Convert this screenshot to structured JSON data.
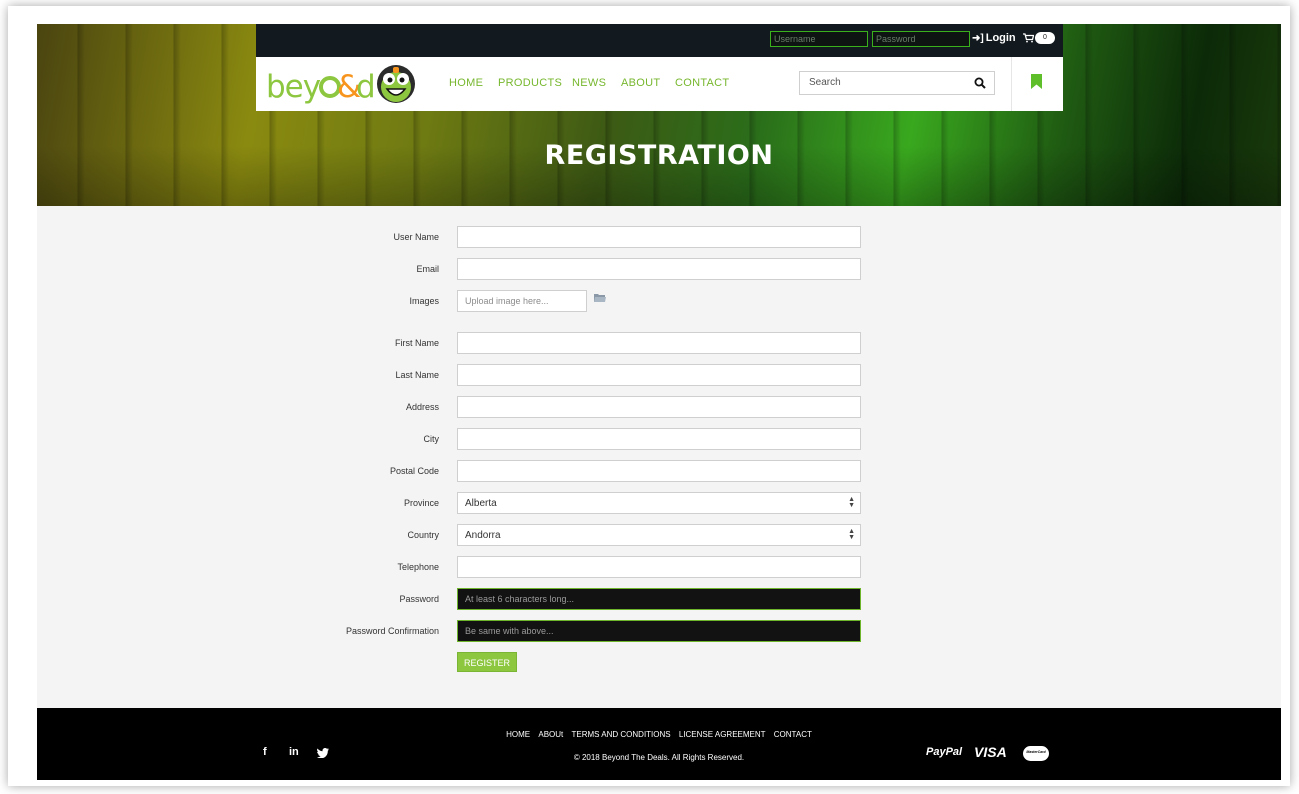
{
  "topbar": {
    "username_placeholder": "Username",
    "password_placeholder": "Password",
    "login_label": "Login",
    "cart_count": "0"
  },
  "brand": {
    "logo_text": "beyo8d"
  },
  "nav": {
    "items": [
      {
        "label": "HOME"
      },
      {
        "label": "PRODUCTS"
      },
      {
        "label": "NEWS"
      },
      {
        "label": "ABOUT"
      },
      {
        "label": "CONTACT"
      }
    ],
    "search_placeholder": "Search"
  },
  "hero": {
    "title": "REGISTRATION"
  },
  "form": {
    "username_label": "User Name",
    "email_label": "Email",
    "images_label": "Images",
    "images_placeholder": "Upload image here...",
    "first_name_label": "First Name",
    "last_name_label": "Last Name",
    "address_label": "Address",
    "city_label": "City",
    "postal_label": "Postal Code",
    "province_label": "Province",
    "province_value": "Alberta",
    "country_label": "Country",
    "country_value": "Andorra",
    "telephone_label": "Telephone",
    "password_label": "Password",
    "password_placeholder": "At least 6 characters long...",
    "confirm_label": "Password Confirmation",
    "confirm_placeholder": "Be same with above...",
    "register_label": "REGISTER"
  },
  "footer": {
    "links": [
      {
        "label": "HOME"
      },
      {
        "label": "ABOUt"
      },
      {
        "label": "TERMS AND CONDITIONS"
      },
      {
        "label": "LICENSE AGREEMENT"
      },
      {
        "label": "CONTACT"
      }
    ],
    "copyright": "© 2018 Beyond The Deals. All Rights Reserved.",
    "social": [
      {
        "label": "f"
      },
      {
        "label": "in"
      }
    ],
    "payments": [
      {
        "label": "PayPal"
      },
      {
        "label": "VISA"
      },
      {
        "label": "MasterCard"
      }
    ]
  },
  "colors": {
    "accent": "#8dc63f",
    "topbar": "#121a1f",
    "footer": "#000000"
  }
}
